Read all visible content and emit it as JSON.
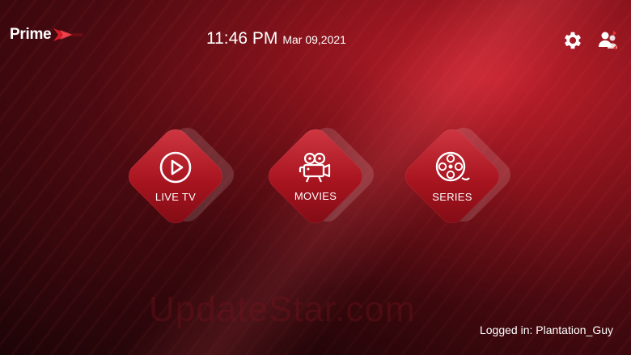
{
  "header": {
    "logo_text": "Prime",
    "time": "11:46 PM",
    "date": "Mar 09,2021",
    "settings_icon": "gear-icon",
    "users_icon": "switch-user-icon"
  },
  "tiles": [
    {
      "label": "LIVE TV",
      "icon": "play-circle-icon"
    },
    {
      "label": "MOVIES",
      "icon": "movie-camera-icon"
    },
    {
      "label": "SERIES",
      "icon": "film-reel-icon"
    }
  ],
  "footer": {
    "watermark": "UpdateStar.com",
    "logged_in": "Logged in: Plantation_Guy"
  },
  "colors": {
    "accent": "#b3161f",
    "background": "#230609"
  }
}
